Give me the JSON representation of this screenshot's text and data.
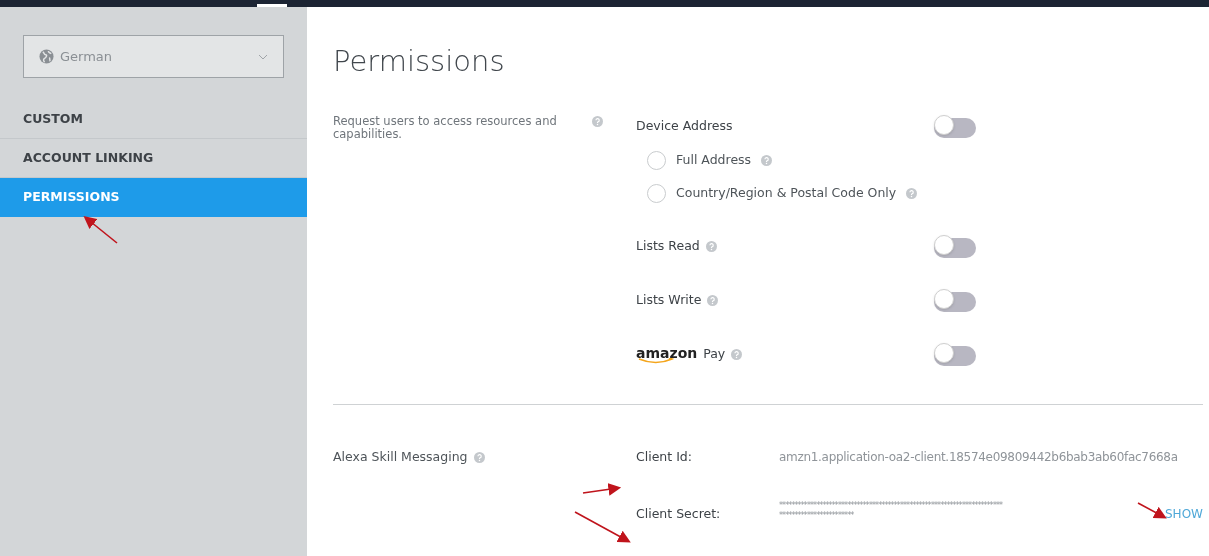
{
  "sidebar": {
    "language": "German",
    "items": [
      {
        "label": "CUSTOM",
        "selected": false
      },
      {
        "label": "ACCOUNT LINKING",
        "selected": false
      },
      {
        "label": "PERMISSIONS",
        "selected": true
      }
    ]
  },
  "title": "Permissions",
  "permissions": {
    "description": "Request users to access resources and capabilities.",
    "items": [
      {
        "kind": "toggle",
        "label": "Device Address",
        "on": false,
        "options": [
          {
            "label": "Full Address",
            "selected": false,
            "help": true
          },
          {
            "label": "Country/Region & Postal Code Only",
            "selected": false,
            "help": true
          }
        ]
      },
      {
        "kind": "toggle",
        "label": "Lists Read",
        "on": false,
        "help": true
      },
      {
        "kind": "toggle",
        "label": "Lists Write",
        "on": false,
        "help": true
      },
      {
        "kind": "brand",
        "brand": "amazon",
        "label": "Pay",
        "on": false,
        "help": true
      }
    ]
  },
  "messaging": {
    "label": "Alexa Skill Messaging",
    "client_id_label": "Client Id:",
    "client_id": "amzn1.application-oa2-client.18574e09809442b6bab3ab60fac7668a",
    "client_secret_label": "Client Secret:",
    "client_secret": "************************************************************************ ************************",
    "show": "SHOW"
  }
}
